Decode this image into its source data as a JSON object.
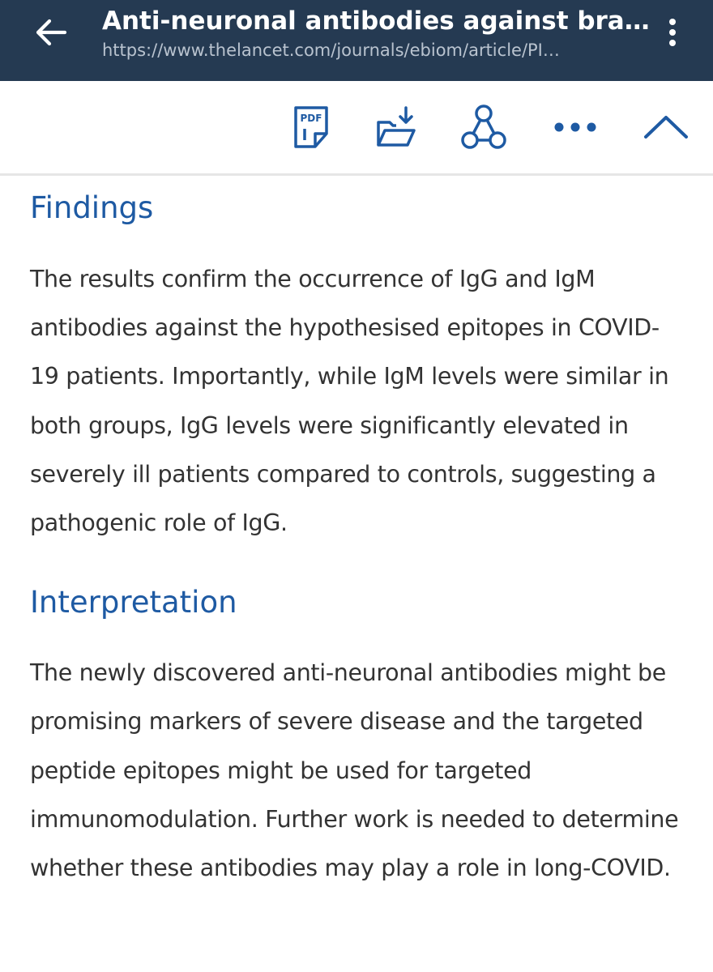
{
  "app_bar": {
    "title": "Anti-neuronal antibodies against brains…",
    "url": "https://www.thelancet.com/journals/ebiom/article/PI…",
    "background": "#253a52"
  },
  "toolbar": {
    "pdf_icon_label": "PDF",
    "icons": [
      "pdf-icon",
      "download-folder-icon",
      "share-icon",
      "more-horizontal-icon",
      "chevron-up-icon"
    ],
    "accent_color": "#1e5aa3"
  },
  "article": {
    "findings": {
      "heading": "Findings",
      "body": "The results confirm the occurrence of IgG and IgM antibodies against the hypothesised epitopes in COVID-19 patients. Importantly, while IgM levels were similar in both groups, IgG levels were significantly elevated in severely ill patients compared to controls, suggesting a pathogenic role of IgG."
    },
    "interpretation": {
      "heading": "Interpretation",
      "body": "The newly discovered anti-neuronal antibodies might be promising markers of severe disease and the targeted peptide epitopes might be used for targeted immunomodulation. Further work is needed to determine whether these antibodies may play a role in long-COVID."
    }
  }
}
